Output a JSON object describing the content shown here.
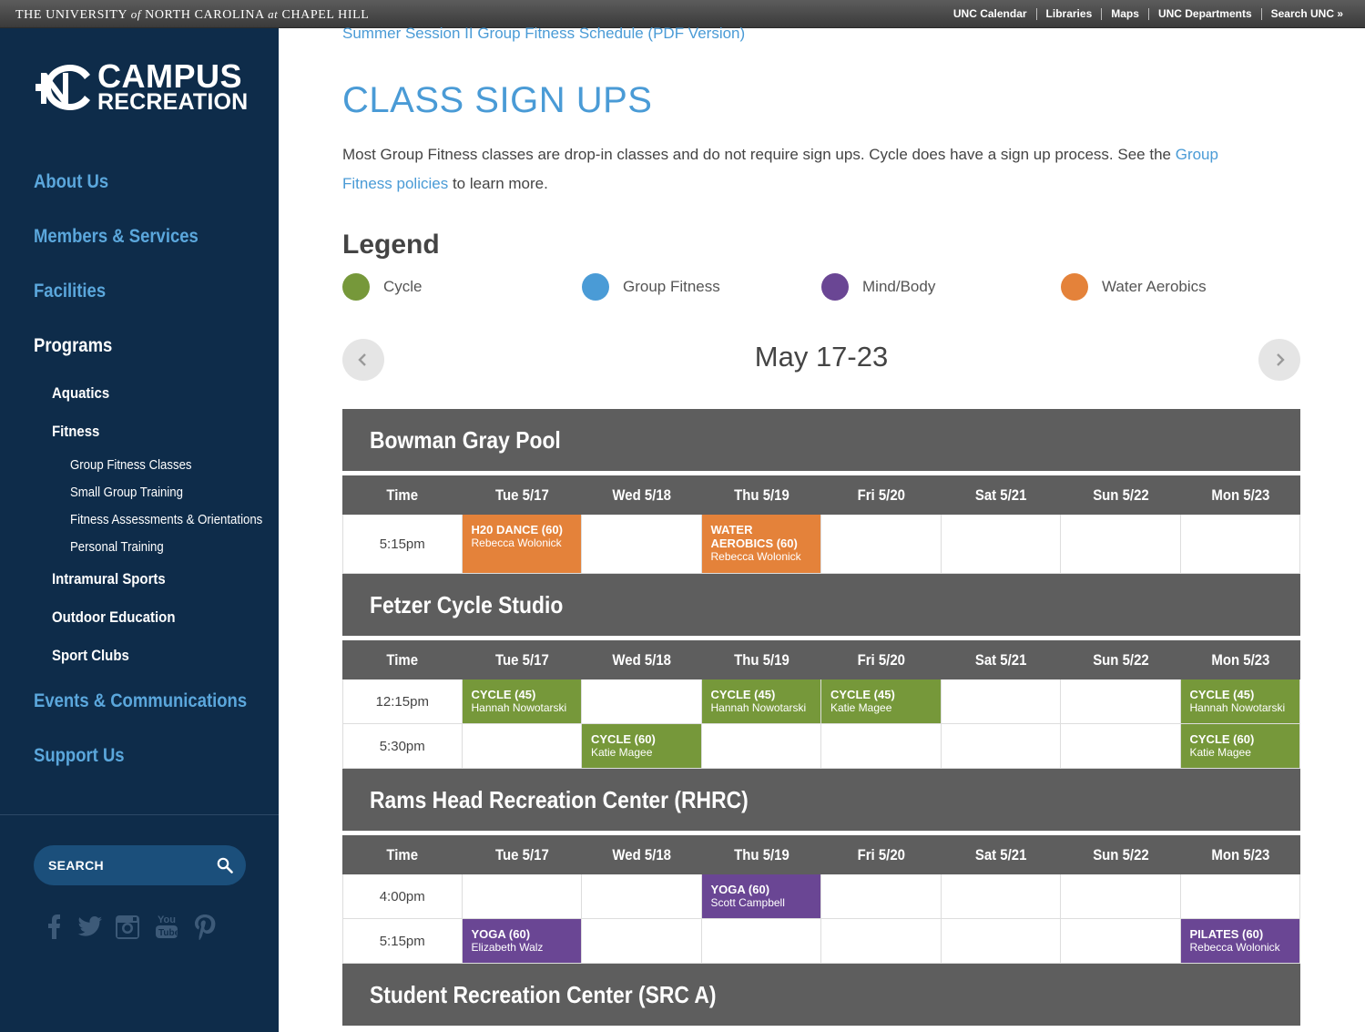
{
  "topbar": {
    "title_pre": "THE UNIVERSITY",
    "title_of": "of",
    "title_mid": "NORTH CAROLINA",
    "title_at": "at",
    "title_post": "CHAPEL HILL",
    "links": [
      "UNC Calendar",
      "Libraries",
      "Maps",
      "UNC Departments",
      "Search UNC »"
    ]
  },
  "sidebar": {
    "logo_line1": "CAMPUS",
    "logo_line2": "RECREATION",
    "nav": {
      "about": "About Us",
      "members": "Members & Services",
      "facilities": "Facilities",
      "programs": "Programs",
      "aquatics": "Aquatics",
      "fitness": "Fitness",
      "group_fitness": "Group Fitness Classes",
      "small_group": "Small Group Training",
      "assessments": "Fitness Assessments & Orientations",
      "personal": "Personal Training",
      "intramural": "Intramural Sports",
      "outdoor": "Outdoor Education",
      "sport_clubs": "Sport Clubs",
      "events": "Events & Communications",
      "support": "Support Us"
    },
    "search_placeholder": "SEARCH",
    "social_icons": [
      "facebook-icon",
      "twitter-icon",
      "instagram-icon",
      "youtube-icon",
      "pinterest-icon"
    ]
  },
  "main": {
    "pdf_link": "Summer Session II Group Fitness Schedule (PDF Version)",
    "title": "CLASS SIGN UPS",
    "intro_text": "Most Group Fitness classes are drop-in classes and do not require sign ups. Cycle does have a sign up process. See the ",
    "intro_link": "Group Fitness policies",
    "intro_tail": " to learn more.",
    "legend_title": "Legend",
    "legend": [
      {
        "label": "Cycle",
        "color": "#76983a"
      },
      {
        "label": "Group Fitness",
        "color": "#4a9bd6"
      },
      {
        "label": "Mind/Body",
        "color": "#6a4694"
      },
      {
        "label": "Water Aerobics",
        "color": "#e4823a"
      }
    ],
    "week_label": "May 17-23"
  },
  "schedule": {
    "days": [
      "Time",
      "Tue 5/17",
      "Wed 5/18",
      "Thu 5/19",
      "Fri 5/20",
      "Sat 5/21",
      "Sun 5/22",
      "Mon 5/23"
    ],
    "locations": [
      {
        "name": "Bowman Gray Pool",
        "rows": [
          {
            "time": "5:15pm",
            "tall": true,
            "cells": [
              {
                "name": "H20 DANCE (60)",
                "instructor": "Rebecca Wolonick",
                "type": "water"
              },
              null,
              {
                "name": "WATER AEROBICS (60)",
                "instructor": "Rebecca Wolonick",
                "type": "water"
              },
              null,
              null,
              null,
              null
            ]
          }
        ]
      },
      {
        "name": "Fetzer Cycle Studio",
        "rows": [
          {
            "time": "12:15pm",
            "cells": [
              {
                "name": "CYCLE (45)",
                "instructor": "Hannah Nowotarski",
                "type": "cycle"
              },
              null,
              {
                "name": "CYCLE (45)",
                "instructor": "Hannah Nowotarski",
                "type": "cycle"
              },
              {
                "name": "CYCLE (45)",
                "instructor": "Katie Magee",
                "type": "cycle"
              },
              null,
              null,
              {
                "name": "CYCLE (45)",
                "instructor": "Hannah Nowotarski",
                "type": "cycle"
              }
            ]
          },
          {
            "time": "5:30pm",
            "cells": [
              null,
              {
                "name": "CYCLE (60)",
                "instructor": "Katie Magee",
                "type": "cycle"
              },
              null,
              null,
              null,
              null,
              {
                "name": "CYCLE (60)",
                "instructor": "Katie Magee",
                "type": "cycle"
              }
            ]
          }
        ]
      },
      {
        "name": "Rams Head Recreation Center (RHRC)",
        "rows": [
          {
            "time": "4:00pm",
            "cells": [
              null,
              null,
              {
                "name": "YOGA (60)",
                "instructor": "Scott Campbell",
                "type": "mind"
              },
              null,
              null,
              null,
              null
            ]
          },
          {
            "time": "5:15pm",
            "cells": [
              {
                "name": "YOGA (60)",
                "instructor": "Elizabeth Walz",
                "type": "mind"
              },
              null,
              null,
              null,
              null,
              null,
              {
                "name": "PILATES (60)",
                "instructor": "Rebecca Wolonick",
                "type": "mind"
              }
            ]
          }
        ]
      },
      {
        "name": "Student Recreation Center (SRC A)",
        "rows": []
      }
    ]
  }
}
